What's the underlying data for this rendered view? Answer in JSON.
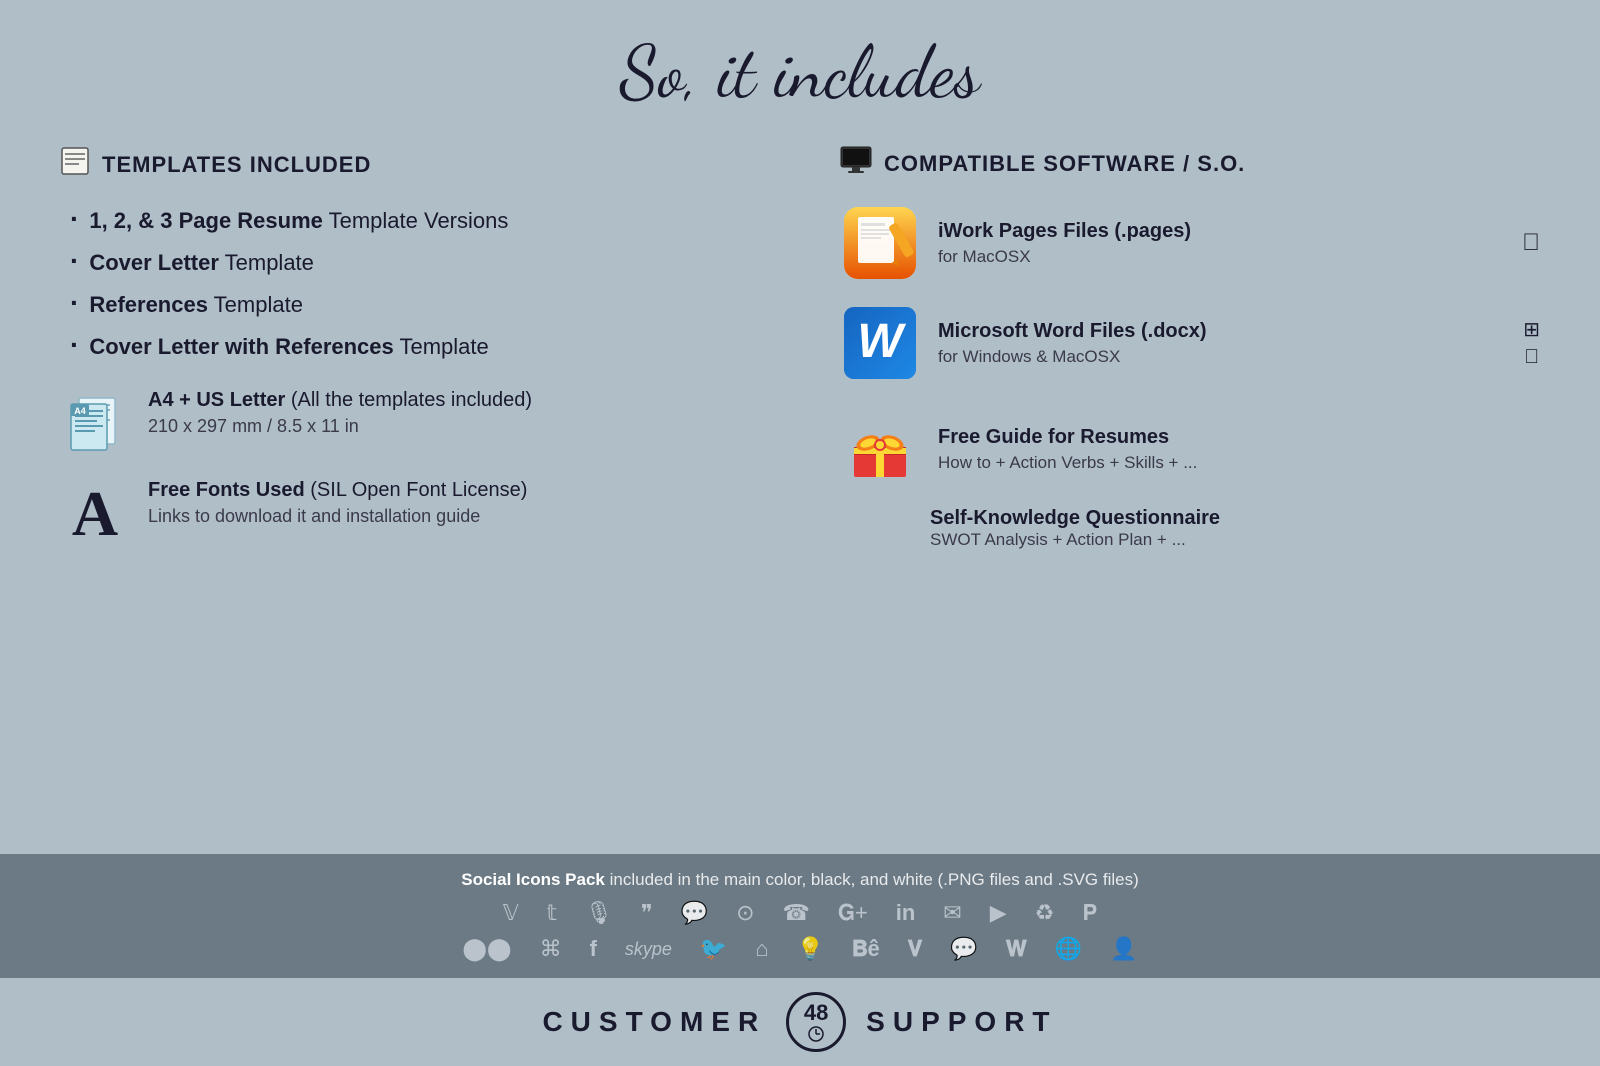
{
  "header": {
    "title": "So, it includes"
  },
  "left": {
    "templates_section": {
      "icon": "🗒",
      "title": "TEMPLATES INCLUDED",
      "items": [
        {
          "bold": "1, 2, & 3 Page Resume",
          "normal": " Template Versions"
        },
        {
          "bold": "Cover Letter",
          "normal": " Template"
        },
        {
          "bold": "References",
          "normal": " Template"
        },
        {
          "bold": "Cover Letter with References",
          "normal": " Template"
        }
      ]
    },
    "features": [
      {
        "id": "a4",
        "title_bold": "A4 + US Letter",
        "title_normal": " (All the templates included)",
        "subtitle": "210 x 297 mm / 8.5 x 11 in"
      },
      {
        "id": "fonts",
        "title_bold": "Free Fonts Used",
        "title_normal": " (SIL Open Font License)",
        "subtitle": "Links to download it and installation guide"
      }
    ]
  },
  "right": {
    "compatible_section": {
      "title": "COMPATIBLE SOFTWARE / S.O."
    },
    "software": [
      {
        "id": "iwork",
        "title": "iWork Pages Files (.pages)",
        "subtitle": "for MacOSX",
        "os": [
          "apple"
        ]
      },
      {
        "id": "word",
        "title": "Microsoft Word Files (.docx)",
        "subtitle": "for Windows & MacOSX",
        "os": [
          "windows",
          "apple"
        ]
      }
    ],
    "extras": [
      {
        "id": "guide",
        "title": "Free Guide for Resumes",
        "subtitle": "How to + Action Verbs + Skills + ..."
      },
      {
        "id": "questionnaire",
        "title": "Self-Knowledge Questionnaire",
        "subtitle": "SWOT Analysis + Action Plan + ..."
      }
    ]
  },
  "social_bar": {
    "text_bold": "Social Icons Pack",
    "text_normal": " included in the main color, black, and white (.PNG files and .SVG files)",
    "icons_row1": [
      "ⓥ",
      "𝕥",
      "🎙",
      "❝",
      "💬",
      "📷",
      "📞",
      "𝐆+",
      "in",
      "✉",
      "▶",
      "♻",
      "𝐏"
    ],
    "icons_row2": [
      "••",
      "⌘",
      "𝐟",
      "skype",
      "🐦",
      "🏠",
      "💡",
      "𝐁𝐞",
      "𝐕",
      "💬",
      "𝐖",
      "🌐",
      "👤"
    ]
  },
  "footer": {
    "left_text": "CUSTOMER",
    "badge_number": "48",
    "right_text": "SUPPORT"
  }
}
